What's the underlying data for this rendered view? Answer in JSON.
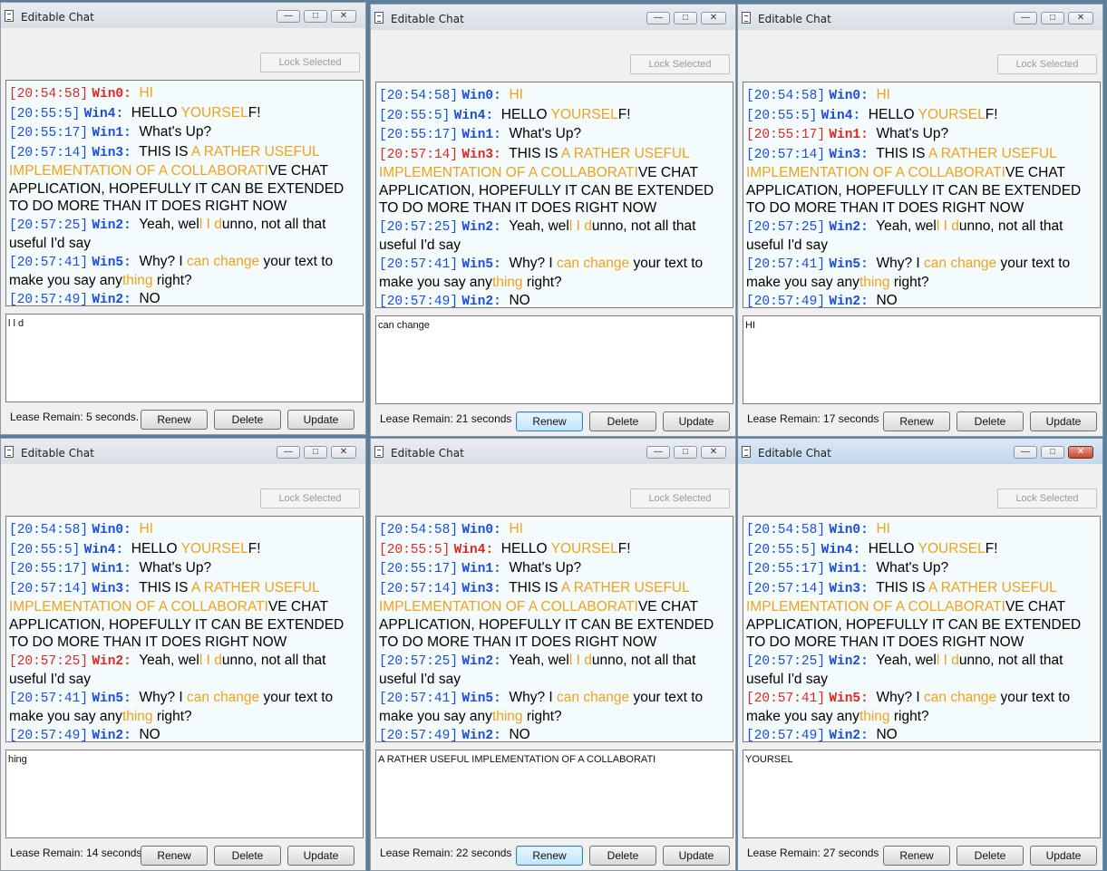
{
  "desktop_color": "#5b7f9a",
  "windows": [
    {
      "title": "Editable Chat",
      "lock_label": "Lock Selected",
      "selected": 0,
      "edit_text": "l l d",
      "lease": "Lease Remain: 5 seconds.",
      "buttons": {
        "renew": "Renew",
        "delete": "Delete",
        "update": "Update"
      }
    },
    {
      "title": "Editable Chat",
      "lock_label": "Lock Selected",
      "selected": 3,
      "edit_text": "can change",
      "lease": "Lease Remain: 21 seconds",
      "buttons": {
        "renew": "Renew",
        "delete": "Delete",
        "update": "Update"
      }
    },
    {
      "title": "Editable Chat",
      "lock_label": "Lock Selected",
      "selected": 2,
      "edit_text": "HI",
      "lease": "Lease Remain: 17 seconds",
      "buttons": {
        "renew": "Renew",
        "delete": "Delete",
        "update": "Update"
      }
    },
    {
      "title": "Editable Chat",
      "lock_label": "Lock Selected",
      "selected": 4,
      "edit_text": "hing",
      "lease": "Lease Remain: 14 seconds",
      "buttons": {
        "renew": "Renew",
        "delete": "Delete",
        "update": "Update"
      }
    },
    {
      "title": "Editable Chat",
      "lock_label": "Lock Selected",
      "selected": 1,
      "edit_text": "A RATHER USEFUL IMPLEMENTATION OF A COLLABORATI",
      "lease": "Lease Remain: 22 seconds",
      "buttons": {
        "renew": "Renew",
        "delete": "Delete",
        "update": "Update"
      }
    },
    {
      "title": "Editable Chat",
      "lock_label": "Lock Selected",
      "selected": 5,
      "edit_text": "YOURSEL",
      "lease": "Lease Remain: 27 seconds",
      "buttons": {
        "renew": "Renew",
        "delete": "Delete",
        "update": "Update"
      }
    }
  ],
  "messages": [
    {
      "time": "[20:54:58]",
      "who": "Win0:",
      "parts": [
        {
          "t": "HI",
          "hl": true
        }
      ]
    },
    {
      "time": "[20:55:5]",
      "who": "Win4:",
      "parts": [
        {
          "t": "HELLO ",
          "hl": false
        },
        {
          "t": "YOURSEL",
          "hl": true
        },
        {
          "t": "F!",
          "hl": false
        }
      ]
    },
    {
      "time": "[20:55:17]",
      "who": "Win1:",
      "parts": [
        {
          "t": "What's Up?",
          "hl": false
        }
      ]
    },
    {
      "time": "[20:57:14]",
      "who": "Win3:",
      "parts": [
        {
          "t": "THIS IS ",
          "hl": false
        },
        {
          "t": "A RATHER USEFUL IMPLEMENTATION OF A COLLABORATI",
          "hl": true
        },
        {
          "t": "VE CHAT APPLICATION, HOPEFULLY IT CAN BE EXTENDED TO DO MORE THAN IT DOES RIGHT NOW",
          "hl": false
        }
      ]
    },
    {
      "time": "[20:57:25]",
      "who": "Win2:",
      "parts": [
        {
          "t": "Yeah, wel",
          "hl": false
        },
        {
          "t": "l I d",
          "hl": true
        },
        {
          "t": "unno, not all that useful I'd say",
          "hl": false
        }
      ]
    },
    {
      "time": "[20:57:41]",
      "who": "Win5:",
      "parts": [
        {
          "t": "Why? I ",
          "hl": false
        },
        {
          "t": "can change",
          "hl": true
        },
        {
          "t": " your text to make you say any",
          "hl": false
        },
        {
          "t": "thing",
          "hl": true
        },
        {
          "t": " right?",
          "hl": false
        }
      ]
    },
    {
      "time": "[20:57:49]",
      "who": "Win2:",
      "parts": [
        {
          "t": "NO",
          "hl": false
        }
      ]
    }
  ],
  "icons": {
    "app": "notepad-icon",
    "minimize": "minimize-icon",
    "maximize": "maximize-icon",
    "close": "close-icon"
  },
  "colors": {
    "timestamp": "#1c4ddb",
    "selected_message": "#e0281f",
    "edited_highlight": "#f0a21a"
  }
}
